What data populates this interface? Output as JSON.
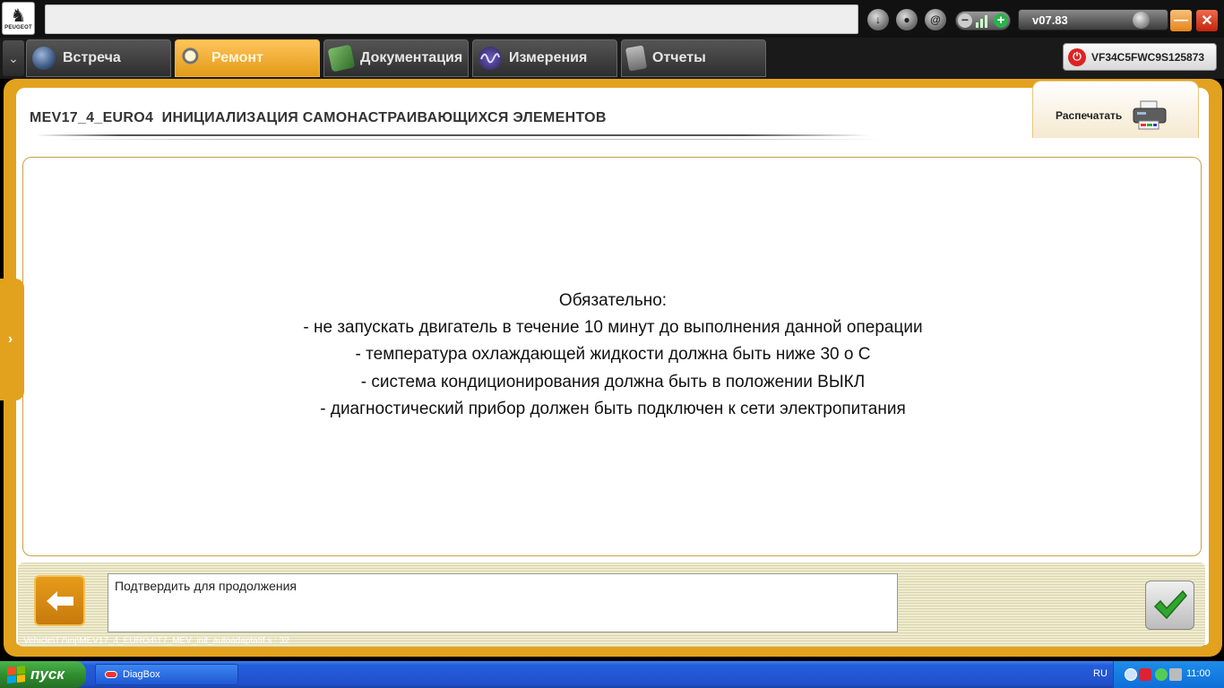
{
  "app": {
    "brand": "PEUGEOT",
    "version": "v07.83"
  },
  "tabs": [
    {
      "label": "Встреча",
      "icon": "globe-icon",
      "active": false
    },
    {
      "label": "Ремонт",
      "icon": "magnifier-icon",
      "active": true
    },
    {
      "label": "Документация",
      "icon": "book-icon",
      "active": false
    },
    {
      "label": "Измерения",
      "icon": "waveform-icon",
      "active": false
    },
    {
      "label": "Отчеты",
      "icon": "document-icon",
      "active": false
    }
  ],
  "vehicle": {
    "vin": "VF34C5FWC9S125873"
  },
  "page": {
    "title": "MEV17_4_EURO4  ИНИЦИАЛИЗАЦИЯ САМОНАСТРАИВАЮЩИХСЯ ЭЛЕМЕНТОВ",
    "print_label": "Распечатать"
  },
  "message": {
    "lines": [
      "Обязательно:",
      "- не запускать двигатель в течение 10 минут до выполнения данной операции",
      "- температура охлаждающей жидкости должна быть ниже 30 о С",
      "- система кондиционирования должна быть в положении ВЫКЛ",
      "- диагностический прибор должен быть подключен к сети электропитания"
    ]
  },
  "bottom": {
    "prompt": "Подтвердить для продолжения",
    "script_path": "Vehicle\\T7\\inj\\MEV17_4_EURO4\\T7_MEV_init_autoadaptatif.s : 32"
  },
  "taskbar": {
    "start_label": "пуск",
    "task_label": "DiagBox",
    "language": "RU",
    "clock": "11:00"
  },
  "colors": {
    "accent_orange": "#e2a21e",
    "active_tab": "#f0ad2e",
    "taskbar_blue": "#245edb",
    "start_green": "#2f8f2f"
  }
}
